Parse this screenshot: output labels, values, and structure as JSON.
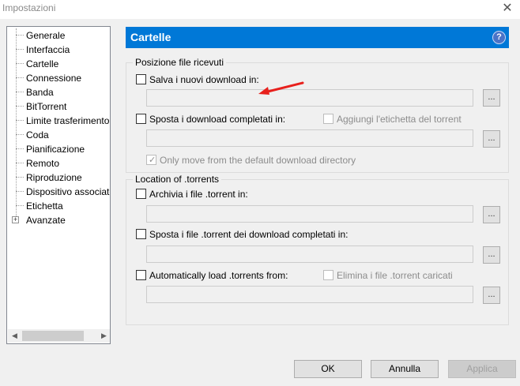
{
  "window": {
    "title": "Impostazioni"
  },
  "sidebar": {
    "items": [
      {
        "label": "Generale"
      },
      {
        "label": "Interfaccia"
      },
      {
        "label": "Cartelle"
      },
      {
        "label": "Connessione"
      },
      {
        "label": "Banda"
      },
      {
        "label": "BitTorrent"
      },
      {
        "label": "Limite trasferimento"
      },
      {
        "label": "Coda"
      },
      {
        "label": "Pianificazione"
      },
      {
        "label": "Remoto"
      },
      {
        "label": "Riproduzione"
      },
      {
        "label": "Dispositivo associato"
      },
      {
        "label": "Etichetta"
      },
      {
        "label": "Avanzate"
      }
    ],
    "selected": "Cartelle"
  },
  "header": {
    "title": "Cartelle",
    "help_label": "?"
  },
  "received": {
    "legend": "Posizione file ricevuti",
    "save_new_label": "Salva i nuovi download in:",
    "move_completed_label": "Sposta i download completati in:",
    "append_label_label": "Aggiungi l'etichetta del torrent",
    "only_move_label": "Only move from the default download directory",
    "browse_label": "..."
  },
  "torrents": {
    "legend": "Location of .torrents",
    "archive_label": "Archivia i file .torrent in:",
    "move_completed_label": "Sposta i file .torrent dei download completati in:",
    "autoload_label": "Automatically load .torrents from:",
    "delete_loaded_label": "Elimina i file .torrent caricati",
    "browse_label": "..."
  },
  "footer": {
    "ok_label": "OK",
    "cancel_label": "Annulla",
    "apply_label": "Applica"
  },
  "colors": {
    "accent": "#0078d7",
    "annotation_arrow": "#e8201c"
  }
}
